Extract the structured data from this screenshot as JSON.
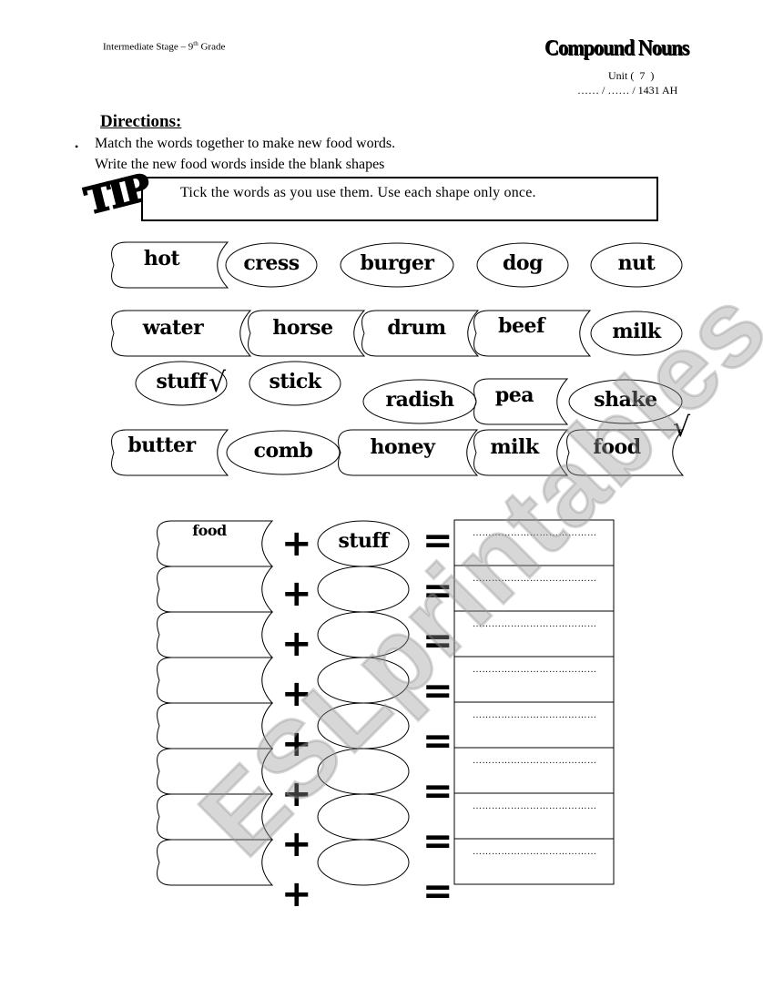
{
  "header": {
    "stage_text": "Intermediate Stage – 9",
    "stage_sup": "th",
    "stage_suffix": " Grade",
    "title": "Compound Nouns",
    "unit": "Unit (  7  )",
    "date": "…… / …… / 1431 AH"
  },
  "directions": {
    "heading": "Directions:",
    "bullet": "•",
    "line1": "Match the words together to make new food words.",
    "line2": "Write the new food words inside the blank shapes"
  },
  "tip": {
    "logo": "TIP",
    "text": "Tick the words as you use them. Use each shape only once."
  },
  "word_bank": [
    {
      "word": "hot",
      "shape": "scroll",
      "ticked": false
    },
    {
      "word": "cress",
      "shape": "oval",
      "ticked": false
    },
    {
      "word": "burger",
      "shape": "oval",
      "ticked": false
    },
    {
      "word": "dog",
      "shape": "oval",
      "ticked": false
    },
    {
      "word": "nut",
      "shape": "oval",
      "ticked": false
    },
    {
      "word": "water",
      "shape": "scroll",
      "ticked": false
    },
    {
      "word": "horse",
      "shape": "scroll",
      "ticked": false
    },
    {
      "word": "drum",
      "shape": "scroll",
      "ticked": false
    },
    {
      "word": "beef",
      "shape": "scroll",
      "ticked": false
    },
    {
      "word": "milk",
      "shape": "oval",
      "ticked": false
    },
    {
      "word": "stuff",
      "shape": "oval",
      "ticked": true
    },
    {
      "word": "stick",
      "shape": "oval",
      "ticked": false
    },
    {
      "word": "radish",
      "shape": "oval",
      "ticked": false
    },
    {
      "word": "pea",
      "shape": "scroll",
      "ticked": false
    },
    {
      "word": "shake",
      "shape": "oval",
      "ticked": false
    },
    {
      "word": "butter",
      "shape": "scroll",
      "ticked": false
    },
    {
      "word": "comb",
      "shape": "oval",
      "ticked": false
    },
    {
      "word": "honey",
      "shape": "scroll",
      "ticked": false
    },
    {
      "word": "milk",
      "shape": "scroll",
      "ticked": false
    },
    {
      "word": "food",
      "shape": "scroll",
      "ticked": true
    }
  ],
  "tick_mark": "√",
  "operators": {
    "plus": "+",
    "equals": "="
  },
  "answer_rows": [
    {
      "first": "food",
      "second": "stuff",
      "answer": "…………………………………"
    },
    {
      "first": "",
      "second": "",
      "answer": "…………………………………"
    },
    {
      "first": "",
      "second": "",
      "answer": "…………………………………"
    },
    {
      "first": "",
      "second": "",
      "answer": "…………………………………"
    },
    {
      "first": "",
      "second": "",
      "answer": "…………………………………"
    },
    {
      "first": "",
      "second": "",
      "answer": "…………………………………"
    },
    {
      "first": "",
      "second": "",
      "answer": "…………………………………"
    },
    {
      "first": "",
      "second": "",
      "answer": "…………………………………"
    }
  ],
  "watermark": "ESLprintables.com"
}
